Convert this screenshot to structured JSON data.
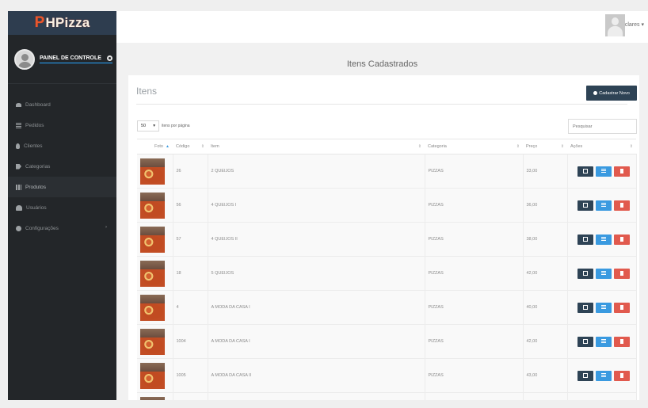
{
  "brand": {
    "logo_mark": "P",
    "logo_text": "HPizza"
  },
  "profile": {
    "label": "PAINEL DE CONTROLE"
  },
  "menu": [
    {
      "label": "Dashboard",
      "icon": "dashboard-icon"
    },
    {
      "label": "Pedidos",
      "icon": "list-icon"
    },
    {
      "label": "Clientes",
      "icon": "person-icon"
    },
    {
      "label": "Categorias",
      "icon": "tag-icon"
    },
    {
      "label": "Produtos",
      "icon": "grid-icon"
    },
    {
      "label": "Usuários",
      "icon": "users-icon"
    },
    {
      "label": "Configurações",
      "icon": "cog-icon",
      "arrow": "›"
    }
  ],
  "topbar": {
    "user_name": "clares ▾"
  },
  "page": {
    "title": "Itens Cadastrados"
  },
  "panel": {
    "title": "Itens",
    "new_button": "Cadastrar Novo",
    "length": {
      "value": "50",
      "arrow": "▾",
      "label": "itens por página"
    },
    "search_placeholder": "Pesquisar"
  },
  "table": {
    "headers": [
      "Foto",
      "Código",
      "Item",
      "Categoria",
      "Preço",
      "Ações"
    ],
    "rows": [
      {
        "code": "26",
        "item": "2 QUEIJOS",
        "category": "PIZZAS",
        "price": "33,00"
      },
      {
        "code": "56",
        "item": "4 QUEIJOS I",
        "category": "PIZZAS",
        "price": "36,00"
      },
      {
        "code": "57",
        "item": "4 QUEIJOS II",
        "category": "PIZZAS",
        "price": "38,00"
      },
      {
        "code": "18",
        "item": "5 QUEIJOS",
        "category": "PIZZAS",
        "price": "42,00"
      },
      {
        "code": "4",
        "item": "A MODA DA CASA I",
        "category": "PIZZAS",
        "price": "40,00"
      },
      {
        "code": "1004",
        "item": "A MODA DA CASA I",
        "category": "PIZZAS",
        "price": "42,00"
      },
      {
        "code": "1005",
        "item": "A MODA DA CASA II",
        "category": "PIZZAS",
        "price": "43,00"
      },
      {
        "code": "",
        "item": "",
        "category": "",
        "price": ""
      }
    ]
  },
  "colors": {
    "sidebar": "#232629",
    "brand_bar": "#2e3d4f",
    "edit": "#2e4355",
    "detail": "#3a9ae0",
    "delete": "#e15a4e"
  }
}
